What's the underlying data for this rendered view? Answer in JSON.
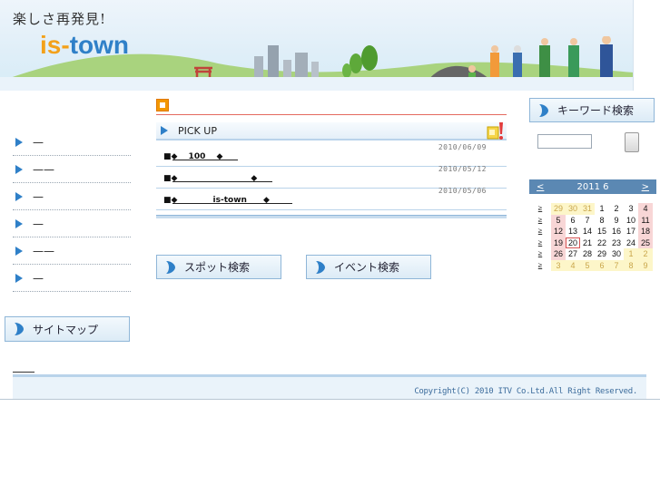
{
  "header": {
    "tagline": "楽しさ再発見!",
    "logo_part1": "is-",
    "logo_part2": "town"
  },
  "nav": {
    "items": [
      "—",
      "——",
      "—",
      "—",
      "——",
      "—"
    ],
    "sitemap_label": "サイトマップ"
  },
  "pickup": {
    "label": "PICK UP",
    "items": [
      {
        "date": "2010/06/09",
        "text": "■◆　 100　 ◆"
      },
      {
        "date": "2010/05/12",
        "text": "■◆　　　　　　　　　◆"
      },
      {
        "date": "2010/05/06",
        "text": "■◆　　　　 is-town　　◆"
      }
    ]
  },
  "search": {
    "spot_label": "スポット検索",
    "event_label": "イベント検索",
    "keyword_label": "キーワード検索",
    "keyword_value": ""
  },
  "calendar": {
    "title": "2011 6",
    "prev": "<",
    "next": ">",
    "week_link": "≥",
    "weeks": [
      {
        "days": [
          "29",
          "30",
          "31",
          "1",
          "2",
          "3",
          "4"
        ],
        "out": [
          true,
          true,
          true,
          false,
          false,
          false,
          false
        ]
      },
      {
        "days": [
          "5",
          "6",
          "7",
          "8",
          "9",
          "10",
          "11"
        ],
        "out": [
          false,
          false,
          false,
          false,
          false,
          false,
          false
        ]
      },
      {
        "days": [
          "12",
          "13",
          "14",
          "15",
          "16",
          "17",
          "18"
        ],
        "out": [
          false,
          false,
          false,
          false,
          false,
          false,
          false
        ]
      },
      {
        "days": [
          "19",
          "20",
          "21",
          "22",
          "23",
          "24",
          "25"
        ],
        "out": [
          false,
          false,
          false,
          false,
          false,
          false,
          false
        ]
      },
      {
        "days": [
          "26",
          "27",
          "28",
          "29",
          "30",
          "1",
          "2"
        ],
        "out": [
          false,
          false,
          false,
          false,
          false,
          true,
          true
        ]
      },
      {
        "days": [
          "3",
          "4",
          "5",
          "6",
          "7",
          "8",
          "9"
        ],
        "out": [
          true,
          true,
          true,
          true,
          true,
          true,
          true
        ]
      }
    ],
    "today": "20"
  },
  "footer": {
    "copyright": "Copyright(C) 2010 ITV Co.Ltd.All Right Reserved."
  },
  "colors": {
    "accent_blue": "#5b88b3",
    "orange": "#f39800",
    "logo_blue": "#2f80c8",
    "logo_orange": "#f3a11a"
  }
}
